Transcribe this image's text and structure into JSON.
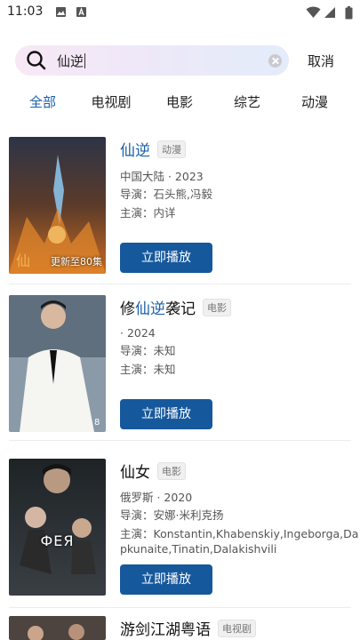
{
  "status_bar": {
    "time": "11:03"
  },
  "search": {
    "query": "仙逆",
    "cancel_label": "取消"
  },
  "tabs": [
    {
      "label": "全部",
      "active": true
    },
    {
      "label": "电视剧",
      "active": false
    },
    {
      "label": "电影",
      "active": false
    },
    {
      "label": "综艺",
      "active": false
    },
    {
      "label": "动漫",
      "active": false
    }
  ],
  "results": [
    {
      "title_pre": "",
      "title_hl": "仙逆",
      "title_post": "",
      "tag": "动漫",
      "region_year": "中国大陆 · 2023",
      "director": "导演：石头熊,冯毅",
      "cast": "主演：内详",
      "poster_badge": "更新至80集",
      "play_label": "立即播放"
    },
    {
      "title_pre": "修",
      "title_hl": "仙逆",
      "title_post": "袭记",
      "tag": "电影",
      "region_year": " · 2024",
      "director": "导演：未知",
      "cast": "主演：未知",
      "poster_badge": "",
      "play_label": "立即播放"
    },
    {
      "title_pre": "仙女",
      "title_hl": "",
      "title_post": "",
      "tag": "电影",
      "region_year": "俄罗斯 · 2020",
      "director": "导演：安娜·米利克扬",
      "cast_line1": "主演：Konstantin,Khabenskiy,Ingeborga,Da",
      "cast_line2": "pkunaite,Tinatin,Dalakishvili",
      "poster_text": "ФЕЯ",
      "play_label": "立即播放"
    },
    {
      "title_pre": "游剑江湖粤语",
      "title_hl": "",
      "title_post": "",
      "tag": "电视剧"
    }
  ],
  "colors": {
    "accent": "#1a5fa8",
    "button": "#16589c"
  }
}
